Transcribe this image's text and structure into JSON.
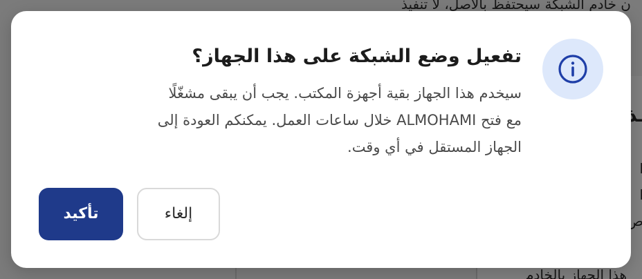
{
  "dialog": {
    "title": "تفعيل وضع الشبكة على هذا الجهاز؟",
    "body_lines": [
      "سيخدم هذا الجهاز بقية أجهزة المكتب. يجب أن يبقى مشغّلًا",
      "مع فتح ALMOHAMI خلال ساعات العمل. يمكنكم العودة إلى",
      "الجهاز المستقل في أي وقت."
    ],
    "cancel_label": "إلغاء",
    "confirm_label": "تأكيد",
    "icon": "info-icon"
  },
  "background": {
    "top_text": "ن خادم الشبكة سيحتفظ بالأصل، لا تنفيذ",
    "right_heading": "ـذ",
    "right_chars": [
      "ـذ",
      "ا",
      "ص"
    ],
    "bottom_text": "هذا الجهاز بالخادم"
  },
  "colors": {
    "accent": "#1f3a8a",
    "icon_bg": "#dde8fb",
    "icon_stroke": "#1f3fa8"
  }
}
